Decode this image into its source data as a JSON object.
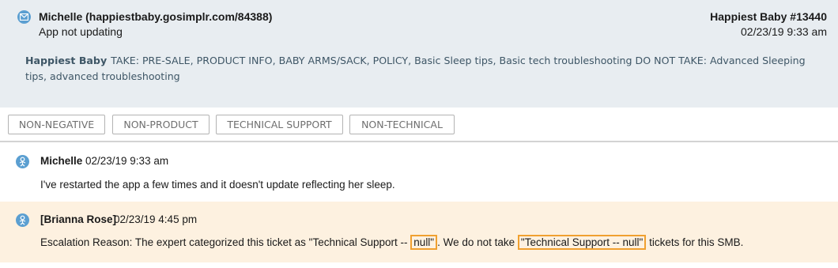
{
  "header": {
    "customer": "Michelle (happiestbaby.gosimplr.com/84388)",
    "subject": "App not updating",
    "brand_ticket": "Happiest Baby #13440",
    "ticket_date": "02/23/19 9:33 am",
    "brand_name": "Happiest Baby",
    "policy": "TAKE: PRE-SALE, PRODUCT INFO, BABY ARMS/SACK, POLICY, Basic Sleep tips, Basic tech troubleshooting DO NOT TAKE: Advanced Sleeping tips, advanced troubleshooting"
  },
  "tags": [
    "NON-NEGATIVE",
    "NON-PRODUCT",
    "TECHNICAL SUPPORT",
    "NON-TECHNICAL"
  ],
  "messages": [
    {
      "author": "Michelle",
      "timestamp": "02/23/19  9:33 am",
      "body": "I've restarted the app a few times and it doesn't update reflecting her sleep."
    },
    {
      "author": "[Brianna Rose]",
      "timestamp": "02/23/19  4:45 pm",
      "body_part1": "Escalation Reason: The expert categorized this ticket as \"Technical Support --",
      "body_hl1": "null\"",
      "body_part2": ". We do not take ",
      "body_hl2": "\"Technical Support -- null\"",
      "body_part3": " tickets for this SMB."
    }
  ],
  "colors": {
    "header_bg": "#e8edf1",
    "policy_text": "#3e5666",
    "icon_blue": "#5b9fd1",
    "agent_bg": "#fdf1e0",
    "highlight": "#f0a030"
  },
  "icons": {
    "header": "envelope-icon",
    "customer_message": "user-icon",
    "agent_message": "expert-icon"
  }
}
